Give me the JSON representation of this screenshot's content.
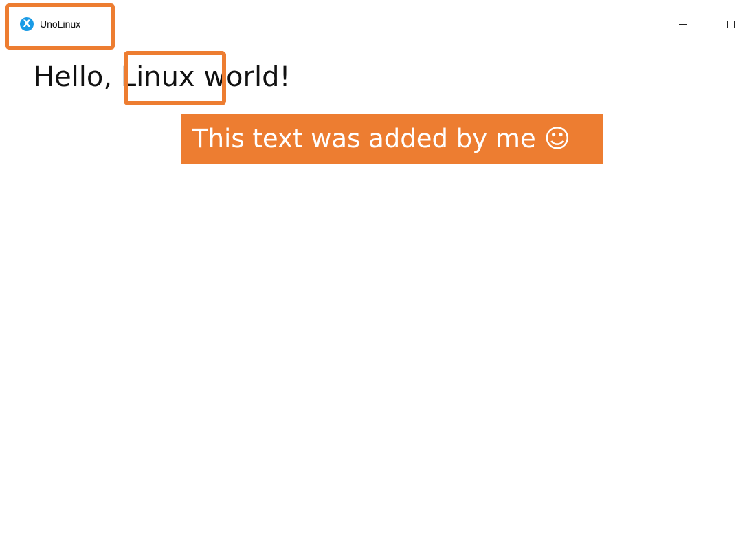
{
  "window": {
    "title": "UnoLinux",
    "icon": "uno-platform-logo-icon",
    "controls": {
      "minimize_icon": "minimize-icon",
      "maximize_icon": "maximize-icon"
    }
  },
  "content": {
    "greeting_prefix": "Hello, ",
    "greeting_highlight": "Linux",
    "greeting_suffix": " world!"
  },
  "annotations": {
    "callout_text": "This text was added by me ☺",
    "highlight_color": "#ed7d31",
    "icon_color": "#1a9be6"
  }
}
